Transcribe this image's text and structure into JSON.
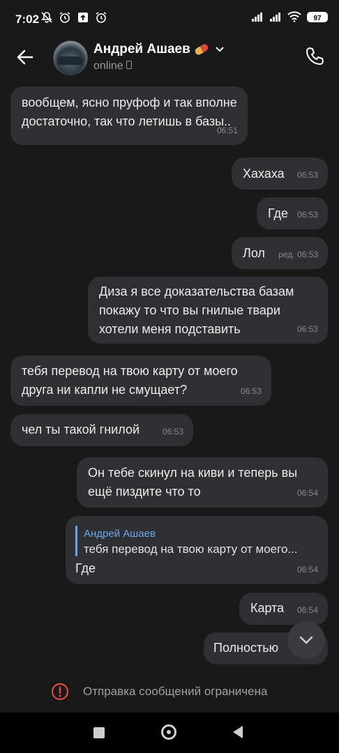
{
  "status_bar": {
    "time": "7:02",
    "battery": "97"
  },
  "header": {
    "name": "Андрей Ашаев",
    "status": "online"
  },
  "messages": [
    {
      "dir": "in",
      "lines": [
        "вообщем, ясно пруфоф и так вполне",
        "достаточно, так что летишь в базы.."
      ],
      "time": "06:51"
    },
    {
      "dir": "out",
      "lines": [
        "Хахаха"
      ],
      "time": "06:53"
    },
    {
      "dir": "out",
      "lines": [
        "Где"
      ],
      "time": "06:53"
    },
    {
      "dir": "out",
      "lines": [
        "Лол"
      ],
      "time": "ред. 06:53"
    },
    {
      "dir": "out",
      "lines": [
        "Диза я все доказательства базам",
        "покажу то что вы гнилые твари",
        "хотели меня подставить"
      ],
      "time": "06:53"
    },
    {
      "dir": "in",
      "lines": [
        "тебя перевод на твою карту от моего",
        "друга ни капли не смущает?"
      ],
      "time": "06:53"
    },
    {
      "dir": "in",
      "lines": [
        "чел ты такой гнилой"
      ],
      "time": "06:53"
    },
    {
      "dir": "out",
      "lines": [
        "Он тебе скинул на киви и теперь вы",
        "ещё пиздите что то"
      ],
      "time": "06:54"
    },
    {
      "dir": "out",
      "reply_name": "Андрей Ашаев",
      "reply_text": "тебя перевод на твою карту от моего...",
      "lines": [
        "Где"
      ],
      "time": "06:54"
    },
    {
      "dir": "out",
      "lines": [
        "Карта"
      ],
      "time": "06:54"
    },
    {
      "dir": "out",
      "lines": [
        "Полностью"
      ],
      "time": ""
    }
  ],
  "footer": {
    "restricted_text": "Отправка сообщений ограничена"
  },
  "icons": {
    "back": "arrow-left-icon",
    "call": "phone-icon",
    "scroll": "chevron-down-icon",
    "warning": "alert-circle-icon"
  }
}
